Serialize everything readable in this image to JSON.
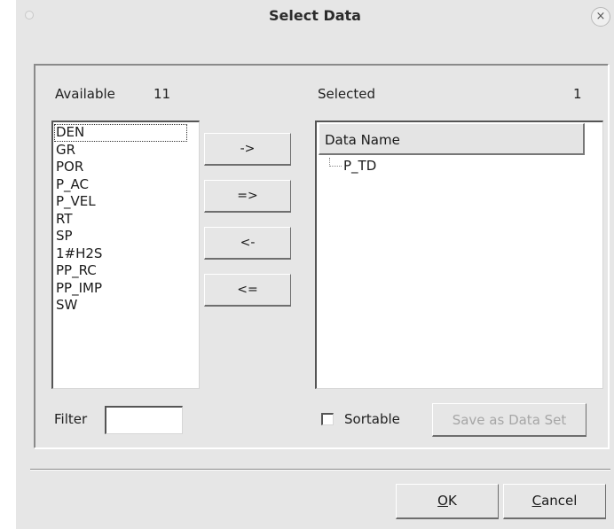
{
  "window": {
    "title": "Select Data",
    "close_glyph": "×"
  },
  "available": {
    "label": "Available",
    "count": "11",
    "items": [
      "DEN",
      "GR",
      "POR",
      "P_AC",
      "P_VEL",
      "RT",
      "SP",
      "1#H2S",
      "PP_RC",
      "PP_IMP",
      "SW"
    ],
    "focused_item": "DEN"
  },
  "buttons": {
    "move_one_right": "->",
    "move_all_right": "=>",
    "move_one_left": "<-",
    "move_all_left": "<="
  },
  "selected": {
    "label": "Selected",
    "count": "1",
    "column_header": "Data Name",
    "items": [
      "P_TD"
    ]
  },
  "filter": {
    "label": "Filter",
    "value": ""
  },
  "sortable": {
    "label": "Sortable",
    "checked": false
  },
  "save_data_set": {
    "label": "Save as Data Set",
    "enabled": false
  },
  "footer": {
    "ok_accel": "O",
    "ok_rest": "K",
    "cancel_accel": "C",
    "cancel_rest": "ancel"
  }
}
